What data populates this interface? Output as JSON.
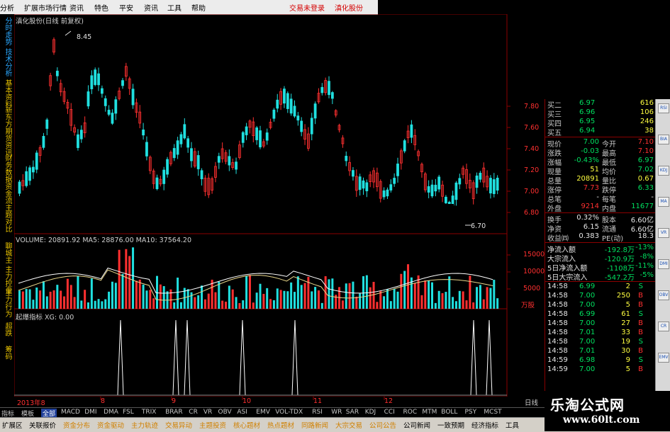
{
  "menu": {
    "items": [
      "分析",
      "扩展市场行情",
      "资讯",
      "特色",
      "平安",
      "资讯",
      "工具",
      "帮助"
    ],
    "red_items": [
      "交易未登录",
      "滇化股份"
    ]
  },
  "left_tabs": {
    "top": [
      "分时走势",
      "技术分析",
      "基本资料",
      "新东方",
      "期货资讯",
      "财务数据",
      "资金流",
      "主题对比"
    ],
    "mid": [
      "聊城主",
      "主力控盘",
      "主力行为"
    ],
    "low": [
      "超跌",
      "筹码"
    ]
  },
  "chart": {
    "title": "滇化股份(日线 前复权)",
    "high_label": "8.45",
    "low_label": "6.70",
    "volume_title": "VOLUME: 20891.92  MA5: 28876.00  MA10: 37564.20",
    "indicator_title": "起爆指标  XG: 0.00",
    "price_axis": [
      "7.80",
      "7.60",
      "7.40",
      "7.20",
      "7.00",
      "6.80"
    ],
    "volume_axis": [
      "15000",
      "10000",
      "5000"
    ],
    "date_label": "2013年8",
    "date_ticks": [
      "8",
      "9",
      "10",
      "11",
      "12"
    ],
    "corner_label": "日线",
    "unit_label": "万股"
  },
  "quote": {
    "asks": [
      {
        "label": "买二",
        "price": "6.97",
        "vol": "616"
      },
      {
        "label": "买三",
        "price": "6.96",
        "vol": "106"
      },
      {
        "label": "买四",
        "price": "6.95",
        "vol": "246"
      },
      {
        "label": "买五",
        "price": "6.94",
        "vol": "38"
      }
    ],
    "stats": [
      {
        "l1": "现价",
        "v1": "7.00",
        "l2": "今开",
        "v2": "7.10"
      },
      {
        "l1": "涨跌",
        "v1": "-0.03",
        "l2": "最高",
        "v2": "7.10"
      },
      {
        "l1": "涨幅",
        "v1": "-0.43%",
        "l2": "最低",
        "v2": "6.97"
      },
      {
        "l1": "现量",
        "v1": "51",
        "l2": "均价",
        "v2": "7.02"
      },
      {
        "l1": "总量",
        "v1": "20891",
        "l2": "量比",
        "v2": "0.67"
      },
      {
        "l1": "涨停",
        "v1": "7.73",
        "l2": "跌停",
        "v2": "6.33"
      },
      {
        "l1": "总笔",
        "v1": "-",
        "l2": "每笔",
        "v2": "-"
      },
      {
        "l1": "外盘",
        "v1": "9214",
        "l2": "内盘",
        "v2": "11677"
      }
    ],
    "stats2": [
      {
        "l1": "换手",
        "v1": "0.32%",
        "l2": "股本",
        "v2": "6.60亿"
      },
      {
        "l1": "净资",
        "v1": "6.15",
        "l2": "流通",
        "v2": "6.60亿"
      },
      {
        "l1": "收益㈣",
        "v1": "0.383",
        "l2": "PE(动)",
        "v2": "18.3"
      }
    ],
    "flows": [
      {
        "label": "净流入额",
        "value": "-192.8万",
        "pct": "-13%"
      },
      {
        "label": "大宗流入",
        "value": "-120.9万",
        "pct": "-8%"
      },
      {
        "label": "5日净流入额",
        "value": "-1108万",
        "pct": "-11%"
      },
      {
        "label": "5日大宗流入",
        "value": "-547.2万",
        "pct": "-5%"
      }
    ],
    "ticks": [
      {
        "time": "14:58",
        "price": "6.99",
        "vol": "2",
        "dir": "S"
      },
      {
        "time": "14:58",
        "price": "7.00",
        "vol": "250",
        "dir": "B"
      },
      {
        "time": "14:58",
        "price": "7.00",
        "vol": "5",
        "dir": "B"
      },
      {
        "time": "14:58",
        "price": "6.99",
        "vol": "61",
        "dir": "S"
      },
      {
        "time": "14:58",
        "price": "7.00",
        "vol": "27",
        "dir": "B"
      },
      {
        "time": "14:58",
        "price": "7.01",
        "vol": "33",
        "dir": "B"
      },
      {
        "time": "14:58",
        "price": "7.00",
        "vol": "19",
        "dir": "S"
      },
      {
        "time": "14:58",
        "price": "7.01",
        "vol": "30",
        "dir": "B"
      },
      {
        "time": "14:59",
        "price": "6.98",
        "vol": "9",
        "dir": "S"
      },
      {
        "time": "14:59",
        "price": "7.00",
        "vol": "5",
        "dir": "B"
      }
    ]
  },
  "indicators": {
    "items": [
      "指标",
      "模板",
      "全部",
      "MACD",
      "DMI",
      "DMA",
      "FSL",
      "TRIX",
      "BRAR",
      "CR",
      "VR",
      "OBV",
      "ASI",
      "EMV",
      "VOL-TDX",
      "RSI",
      "WR",
      "SAR",
      "KDJ",
      "CCI",
      "ROC",
      "MTM",
      "BOLL",
      "PSY",
      "MCST"
    ],
    "selected": "全部"
  },
  "bottom_tabs": [
    "扩展区",
    "关联报价",
    "资金分布",
    "资金驱动",
    "主力轨迹",
    "交易异动",
    "主题投资",
    "核心题材",
    "热点题材",
    "同路新闻",
    "大宗交易",
    "公司公告",
    "公司新闻",
    "一致预期",
    "经济指标",
    "工具"
  ],
  "right_toolbar": [
    "RSI",
    "BIA",
    "KDJ",
    "MA",
    "VR",
    "DMI",
    "OBV",
    "CR",
    "EMV"
  ],
  "watermark": {
    "title": "乐淘公式网",
    "url": "www.60lt.com"
  },
  "colors": {
    "up": "#ff3030",
    "down": "#20e0e0",
    "ma5": "#ffffff",
    "ma10": "#e8d68a",
    "signal": "#ffffff"
  }
}
